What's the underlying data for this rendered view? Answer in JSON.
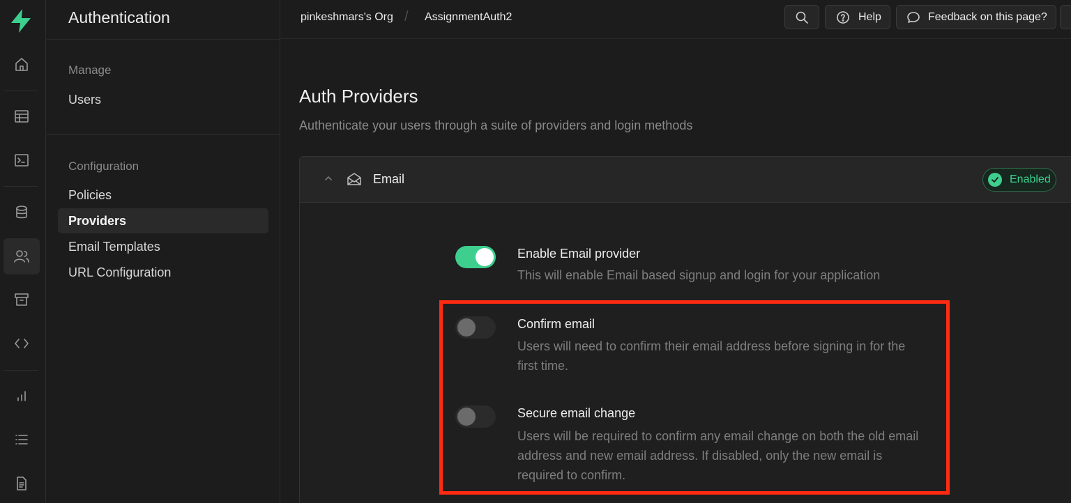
{
  "app": {
    "section_title": "Authentication"
  },
  "rail": {
    "icons": [
      "home-icon",
      "table-editor-icon",
      "sql-editor-icon",
      "database-icon",
      "auth-users-icon",
      "storage-icon",
      "api-icon",
      "reports-icon",
      "logs-icon",
      "docs-icon"
    ],
    "accent": "#3ecf8e"
  },
  "sidebar": {
    "sections": [
      {
        "heading": "Manage",
        "items": [
          {
            "label": "Users"
          }
        ]
      },
      {
        "heading": "Configuration",
        "items": [
          {
            "label": "Policies"
          },
          {
            "label": "Providers",
            "active": true
          },
          {
            "label": "Email Templates"
          },
          {
            "label": "URL Configuration"
          }
        ]
      }
    ]
  },
  "header": {
    "org": "pinkeshmars's Org",
    "separator": "/",
    "project": "AssignmentAuth2",
    "help_label": "Help",
    "feedback_label": "Feedback on this page?"
  },
  "main": {
    "title": "Auth Providers",
    "subtitle": "Authenticate your users through a suite of providers and login methods",
    "provider": {
      "name": "Email",
      "status": "Enabled",
      "settings": [
        {
          "title": "Enable Email provider",
          "description": "This will enable Email based signup and login for your application",
          "enabled": true
        },
        {
          "title": "Confirm email",
          "description": "Users will need to confirm their email address before signing in for the first time.",
          "enabled": false
        },
        {
          "title": "Secure email change",
          "description": "Users will be required to confirm any email change on both the old email address and new email address. If disabled, only the new email is required to confirm.",
          "enabled": false
        }
      ]
    }
  },
  "colors": {
    "brand": "#3ecf8e",
    "highlight": "#ff2a12",
    "background": "#1c1c1c"
  }
}
